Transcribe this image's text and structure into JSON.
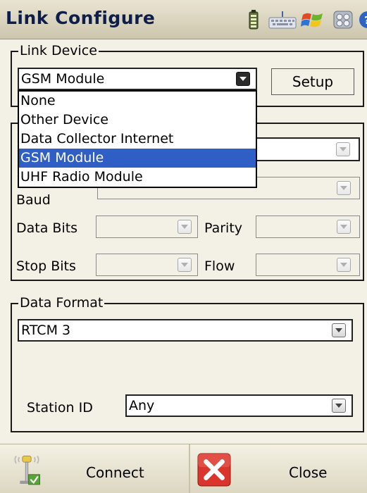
{
  "title": "Link Configure",
  "tray_icons": [
    "battery-icon",
    "keyboard-icon",
    "start-flag-icon",
    "tasks-icon",
    "help-icon"
  ],
  "link_device": {
    "legend": "Link Device",
    "selected": "GSM Module",
    "setup_label": "Setup"
  },
  "dropdown": {
    "options": [
      "None",
      "Other Device",
      "Data Collector Internet",
      "GSM Module",
      "UHF Radio Module"
    ],
    "selected_index": 3
  },
  "port_group": {
    "baud_label": "Baud",
    "data_bits_label": "Data Bits",
    "parity_label": "Parity",
    "stop_bits_label": "Stop Bits",
    "flow_label": "Flow"
  },
  "data_format": {
    "legend": "Data Format",
    "selected": "RTCM 3",
    "station_id_label": "Station ID",
    "station_id_value": "Any"
  },
  "bottom": {
    "connect_label": "Connect",
    "close_label": "Close"
  },
  "colors": {
    "selection": "#2f5ec4",
    "title_text": "#0d1e4a",
    "close_red": "#d9352c"
  }
}
